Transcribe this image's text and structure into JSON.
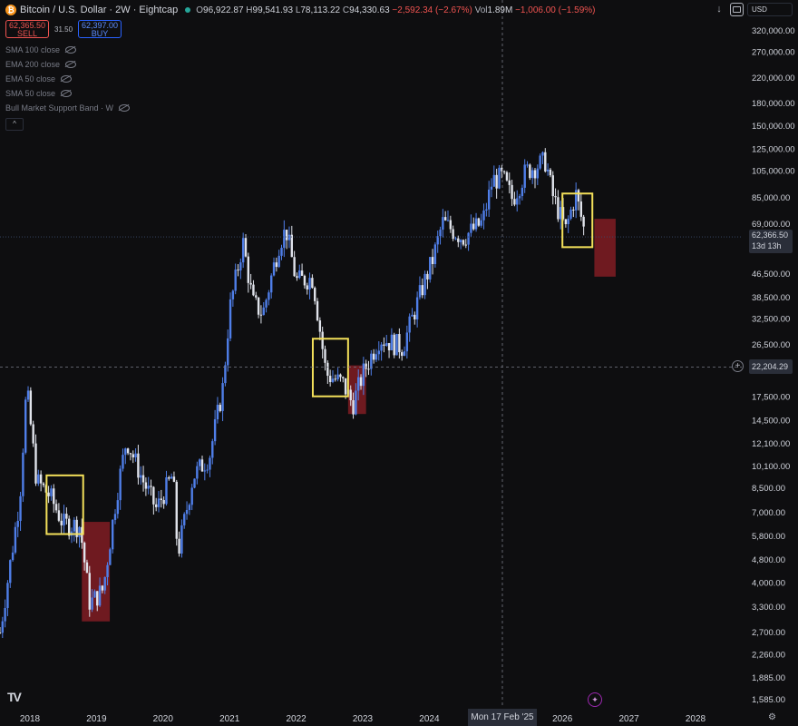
{
  "header": {
    "symbol": "Bitcoin / U.S. Dollar · 2W · Eightcap",
    "o_label": "O",
    "o_value": "96,922.87",
    "h_label": "H",
    "h_value": "99,541.93",
    "l_label": "L",
    "l_value": "78,113.22",
    "c_label": "C",
    "c_value": "94,330.63",
    "change": "−2,592.34 (−2.67%)",
    "vol_label": "Vol",
    "vol_value": "1.89M",
    "vol_change": "−1,006.00 (−1.59%)"
  },
  "trade": {
    "sell_price": "62,365.50",
    "sell_label": "SELL",
    "spread": "31.50",
    "buy_price": "62,397.00",
    "buy_label": "BUY"
  },
  "indicators": [
    "SMA 100 close",
    "EMA 200 close",
    "EMA 50 close",
    "SMA 50 close",
    "Bull Market Support Band · W"
  ],
  "toolbar": {
    "currency": "USD",
    "download_icon": "download-icon",
    "toggle_icon": "panel-toggle-icon",
    "collapse_icon": "chevron-up-icon"
  },
  "price_label": {
    "value": "62,366.50",
    "countdown": "13d 13h"
  },
  "crosshair": {
    "price": "22,204.29",
    "time": "Mon 17 Feb '25"
  },
  "colors": {
    "background": "#0e0e10",
    "candle_up": "#4f7ee8",
    "candle_down": "#e0e3eb",
    "box": "#f3e05a",
    "zone": "#7a1c22",
    "grid": "#2a2e39"
  },
  "chart_data": {
    "type": "candlestick",
    "scale": "log",
    "interval": "2W",
    "price_ticks": [
      "320,000.00",
      "270,000.00",
      "220,000.00",
      "180,000.00",
      "150,000.00",
      "125,000.00",
      "105,000.00",
      "85,000.00",
      "69,000.00",
      "46,500.00",
      "38,500.00",
      "32,500.00",
      "26,500.00",
      "17,500.00",
      "14,500.00",
      "12,100.00",
      "10,100.00",
      "8,500.00",
      "7,000.00",
      "5,800.00",
      "4,800.00",
      "4,000.00",
      "3,300.00",
      "2,700.00",
      "2,260.00",
      "1,885.00",
      "1,585.00"
    ],
    "x_ticks": [
      "2018",
      "2019",
      "2020",
      "2021",
      "2022",
      "2023",
      "2024",
      "2026",
      "2027",
      "2028"
    ],
    "path": [
      [
        2017.55,
        2700
      ],
      [
        2017.75,
        5500
      ],
      [
        2017.85,
        8000
      ],
      [
        2017.95,
        19000
      ],
      [
        2018.1,
        9000
      ],
      [
        2018.3,
        8000
      ],
      [
        2018.5,
        6400
      ],
      [
        2018.75,
        6300
      ],
      [
        2018.9,
        3400
      ],
      [
        2019.1,
        3800
      ],
      [
        2019.3,
        8000
      ],
      [
        2019.45,
        12500
      ],
      [
        2019.7,
        9000
      ],
      [
        2019.9,
        7200
      ],
      [
        2020.15,
        9500
      ],
      [
        2020.22,
        5000
      ],
      [
        2020.45,
        9300
      ],
      [
        2020.7,
        11000
      ],
      [
        2020.9,
        19000
      ],
      [
        2021.0,
        35000
      ],
      [
        2021.2,
        60000
      ],
      [
        2021.35,
        37000
      ],
      [
        2021.5,
        34000
      ],
      [
        2021.75,
        60000
      ],
      [
        2021.85,
        66000
      ],
      [
        2022.0,
        44000
      ],
      [
        2022.25,
        45000
      ],
      [
        2022.45,
        21000
      ],
      [
        2022.7,
        19500
      ],
      [
        2022.85,
        16500
      ],
      [
        2023.0,
        21000
      ],
      [
        2023.25,
        28000
      ],
      [
        2023.6,
        26000
      ],
      [
        2023.9,
        42000
      ],
      [
        2024.05,
        52000
      ],
      [
        2024.2,
        70000
      ],
      [
        2024.5,
        62000
      ],
      [
        2024.8,
        70000
      ],
      [
        2024.95,
        98000
      ],
      [
        2025.1,
        100000
      ],
      [
        2025.25,
        84000
      ],
      [
        2025.45,
        105000
      ],
      [
        2025.75,
        114000
      ],
      [
        2025.85,
        87000
      ],
      [
        2026.05,
        66000
      ],
      [
        2026.2,
        88000
      ],
      [
        2026.35,
        62366.5
      ]
    ],
    "boxes": [
      {
        "x0": 2018.25,
        "x1": 2018.8,
        "y0": 5900,
        "y1": 9400
      },
      {
        "x0": 2022.25,
        "x1": 2022.78,
        "y0": 17600,
        "y1": 27800
      },
      {
        "x0": 2026.0,
        "x1": 2026.45,
        "y0": 57500,
        "y1": 88000
      }
    ],
    "zones": [
      {
        "x0": 2018.78,
        "x1": 2019.2,
        "y0": 2950,
        "y1": 6500
      },
      {
        "x0": 2022.78,
        "x1": 2023.05,
        "y0": 15300,
        "y1": 22500
      },
      {
        "x0": 2026.48,
        "x1": 2026.8,
        "y0": 45500,
        "y1": 72000
      }
    ],
    "current_price": 62366.5,
    "crosshair_price": 22204.29,
    "crosshair_time": "Mon 17 Feb '25"
  }
}
